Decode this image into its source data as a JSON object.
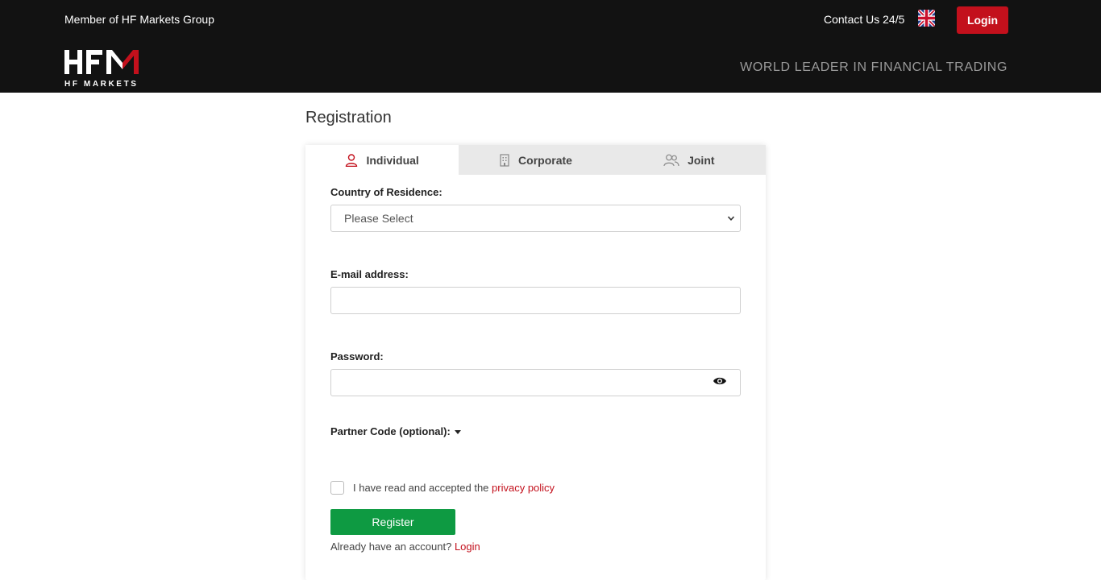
{
  "header": {
    "member_text": "Member of HF Markets Group",
    "contact_label": "Contact Us 24/5",
    "language_flag": "uk-flag-icon",
    "login_label": "Login",
    "logo_main": "HFM",
    "logo_sub": "HF MARKETS",
    "tagline": "WORLD LEADER IN FINANCIAL TRADING"
  },
  "page": {
    "title": "Registration"
  },
  "tabs": [
    {
      "label": "Individual",
      "icon": "user-icon",
      "active": true
    },
    {
      "label": "Corporate",
      "icon": "building-icon",
      "active": false
    },
    {
      "label": "Joint",
      "icon": "users-icon",
      "active": false
    }
  ],
  "form": {
    "country_label": "Country of Residence:",
    "country_value": "Please Select",
    "email_label": "E-mail address:",
    "email_value": "",
    "password_label": "Password:",
    "password_value": "",
    "partner_label": "Partner Code (optional):",
    "privacy_prefix": "I have read and accepted the",
    "privacy_link": "privacy policy",
    "register_label": "Register",
    "already_text": "Already have an account?",
    "already_link": "Login"
  },
  "colors": {
    "brand_red": "#c3101c",
    "register_green": "#0e9a42",
    "header_bg": "#121212"
  }
}
